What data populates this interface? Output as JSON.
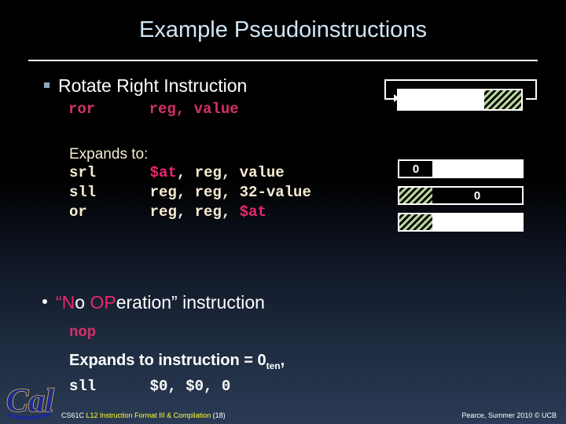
{
  "slide": {
    "title": "Example Pseudoinstructions",
    "background_top": "#000000",
    "background_bottom": "#2b3b55",
    "title_color": "#cfe6f5",
    "accent_pink": "#d4306a",
    "code_cream": "#f7ecd2",
    "hatch_green": "#b8d49c"
  },
  "sections": {
    "rotate": {
      "heading": "Rotate Right Instruction",
      "bullet_glyph": "square-bullet",
      "instruction": {
        "mnemonic": "ror",
        "operands": "reg, value",
        "full": "ror      reg, value"
      },
      "expands_label": "Expands to:",
      "expansion": [
        {
          "mnemonic": "srl",
          "args": "$at, reg, value",
          "full": "srl      $at, reg, value"
        },
        {
          "mnemonic": "sll",
          "args": "reg, reg, 32-value",
          "full": "sll      reg, reg, 32-value"
        },
        {
          "mnemonic": "or",
          "args": "reg, reg, $at",
          "full": "or       reg, reg, $at"
        }
      ]
    },
    "nop": {
      "bullet_glyph": "round-bullet",
      "heading_parts": {
        "open_quote": "“",
        "n": "N",
        "o_lower": "o ",
        "op": "OP",
        "eration": "eration",
        "close_quote": "”",
        "tail": " instruction"
      },
      "heading_full": "“No OPeration” instruction",
      "instruction": "nop",
      "expands_text_prefix": "Expands to instruction = 0",
      "expands_subscript": "ten",
      "expands_text_suffix": ",",
      "code": "sll      $0, $0, 0"
    }
  },
  "diagrams": {
    "rotate_diagram": {
      "label": "rotate-right-wrap-around",
      "segments": [
        {
          "type": "white",
          "width_pct": 70
        },
        {
          "type": "hatch",
          "width_pct": 30
        }
      ]
    },
    "shift_bars": [
      {
        "label": "srl-result-bar",
        "segments": [
          {
            "type": "black",
            "width_pct": 27,
            "text": "0"
          },
          {
            "type": "white",
            "width_pct": 73,
            "text": ""
          }
        ]
      },
      {
        "label": "sll-result-bar",
        "segments": [
          {
            "type": "hatch",
            "width_pct": 27,
            "text": ""
          },
          {
            "type": "black",
            "width_pct": 73,
            "text": "0"
          }
        ]
      },
      {
        "label": "or-result-bar",
        "segments": [
          {
            "type": "hatch",
            "width_pct": 27,
            "text": ""
          },
          {
            "type": "white",
            "width_pct": 73,
            "text": ""
          }
        ]
      }
    ]
  },
  "footer": {
    "course": "CS61C",
    "lecture": "L12 Instruction Format III & Compilation",
    "slide_number": "(18)",
    "credit": "Pearce, Summer 2010 © UCB",
    "logo_text": "Cal"
  }
}
